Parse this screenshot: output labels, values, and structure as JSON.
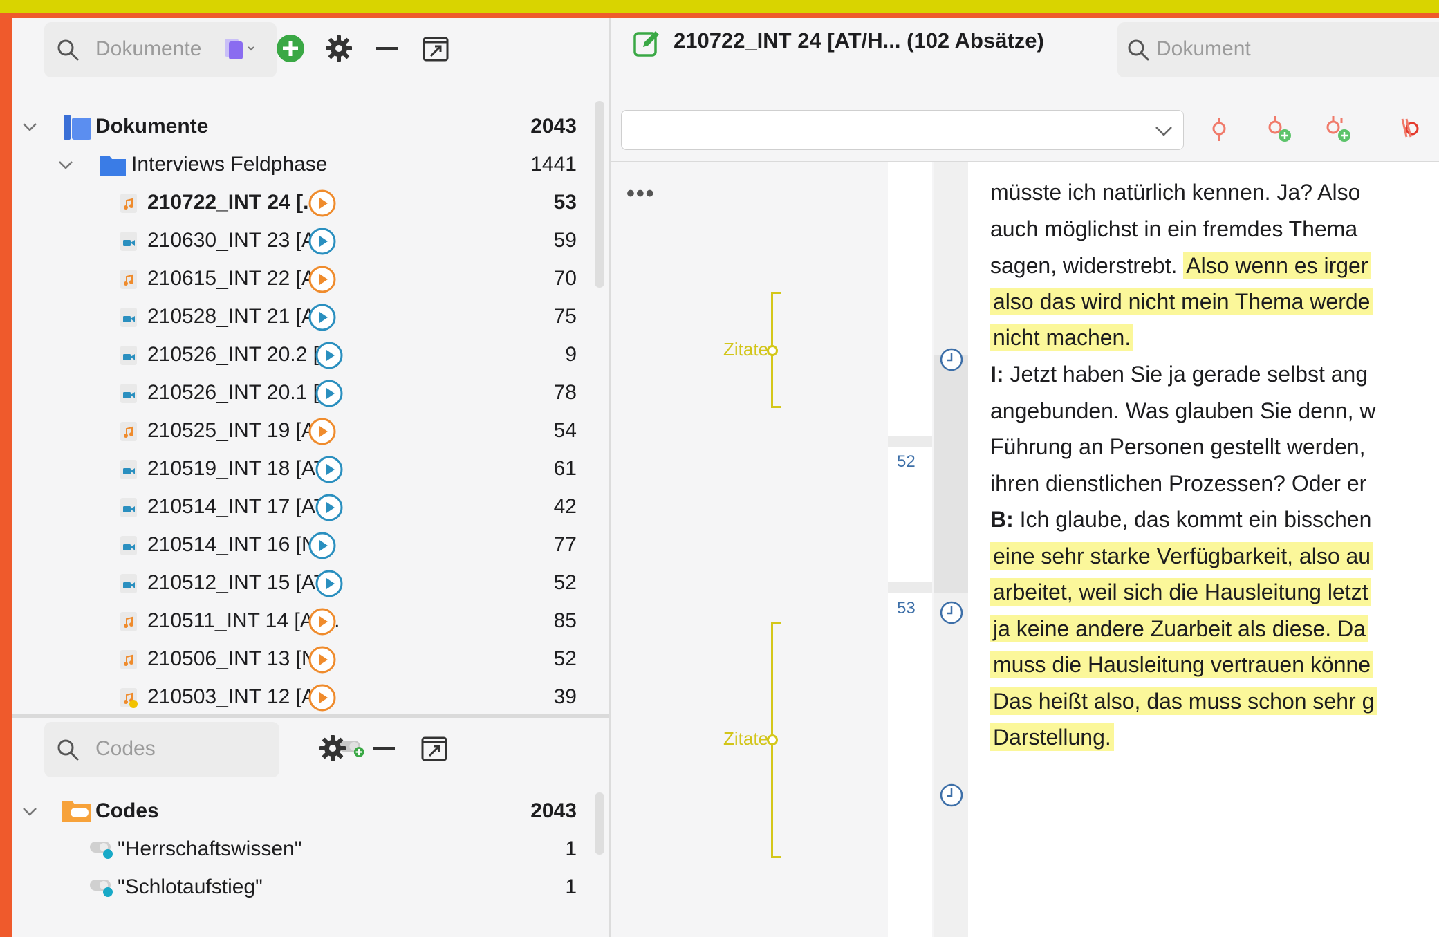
{
  "documents_panel": {
    "search_placeholder": "Dokumente",
    "root": {
      "label": "Dokumente",
      "count": "2043"
    },
    "folder": {
      "label": "Interviews Feldphase",
      "count": "1441"
    },
    "items": [
      {
        "label": "210722_INT 24 [...",
        "count": "53",
        "media": "audio",
        "active": true
      },
      {
        "label": "210630_INT 23 [A...",
        "count": "59",
        "media": "video"
      },
      {
        "label": "210615_INT 22 [A...",
        "count": "70",
        "media": "audio"
      },
      {
        "label": "210528_INT 21 [A...",
        "count": "75",
        "media": "video"
      },
      {
        "label": "210526_INT 20.2 [...",
        "count": "9",
        "media": "video"
      },
      {
        "label": "210526_INT 20.1 [...",
        "count": "78",
        "media": "video"
      },
      {
        "label": "210525_INT 19 [A...",
        "count": "54",
        "media": "audio"
      },
      {
        "label": "210519_INT 18 [AT...",
        "count": "61",
        "media": "video"
      },
      {
        "label": "210514_INT 17 [AT...",
        "count": "42",
        "media": "video"
      },
      {
        "label": "210514_INT 16 [N...",
        "count": "77",
        "media": "video"
      },
      {
        "label": "210512_INT 15 [AT...",
        "count": "52",
        "media": "video"
      },
      {
        "label": "210511_INT 14 [AT...",
        "count": "85",
        "media": "audio"
      },
      {
        "label": "210506_INT 13 [N...",
        "count": "52",
        "media": "audio"
      },
      {
        "label": "210503_INT 12 [A...",
        "count": "39",
        "media": "audio-memo"
      }
    ]
  },
  "codes_panel": {
    "search_placeholder": "Codes",
    "root": {
      "label": "Codes",
      "count": "2043"
    },
    "items": [
      {
        "label": "\"Herrschaftswissen\"",
        "count": "1"
      },
      {
        "label": "\"Schlotaufstieg\"",
        "count": "1"
      }
    ]
  },
  "document_view": {
    "title": "210722_INT 24 [AT/H...   (102 Absätze)",
    "search_placeholder": "Dokument",
    "more": "•••",
    "zitate_label": "Zitate",
    "paragraph_numbers": [
      "52",
      "53"
    ],
    "lines": [
      {
        "speaker": "",
        "text": "müsste ich natürlich kennen. Ja? Also",
        "highlight": false
      },
      {
        "speaker": "",
        "text": "auch möglichst in ein fremdes Thema",
        "highlight": false
      },
      {
        "speaker": "",
        "text": "sagen, widerstrebt. ",
        "hl_text": "Also wenn es irger",
        "highlight": "partial"
      },
      {
        "speaker": "",
        "text": "also das wird nicht mein Thema werde",
        "highlight": true
      },
      {
        "speaker": "",
        "text": "nicht machen.",
        "highlight": true
      },
      {
        "speaker": "I:",
        "text": " Jetzt haben Sie ja gerade selbst ang",
        "highlight": false
      },
      {
        "speaker": "",
        "text": "angebunden. Was glauben Sie denn, w",
        "highlight": false
      },
      {
        "speaker": "",
        "text": "Führung an Personen gestellt werden,",
        "highlight": false
      },
      {
        "speaker": "",
        "text": "ihren dienstlichen Prozessen? Oder er",
        "highlight": false
      },
      {
        "speaker": "B:",
        "text": " Ich glaube, das kommt ein bisschen",
        "highlight": false
      },
      {
        "speaker": "",
        "text": "eine sehr starke Verfügbarkeit, also au",
        "highlight": true
      },
      {
        "speaker": "",
        "text": "arbeitet, weil sich die Hausleitung letzt",
        "highlight": true
      },
      {
        "speaker": "",
        "text": "ja keine andere Zuarbeit als diese. Da",
        "highlight": true
      },
      {
        "speaker": "",
        "text": "muss die Hausleitung vertrauen könne",
        "highlight": true
      },
      {
        "speaker": "",
        "text": "Das heißt also, das muss schon sehr g",
        "highlight": true
      },
      {
        "speaker": "",
        "text": "Darstellung.",
        "highlight": true
      }
    ]
  },
  "colors": {
    "audio": "#ef8b2c",
    "video": "#2a8fbf",
    "highlight": "#fbf79a",
    "zitate": "#d4c71a",
    "add_green": "#3aa845"
  }
}
